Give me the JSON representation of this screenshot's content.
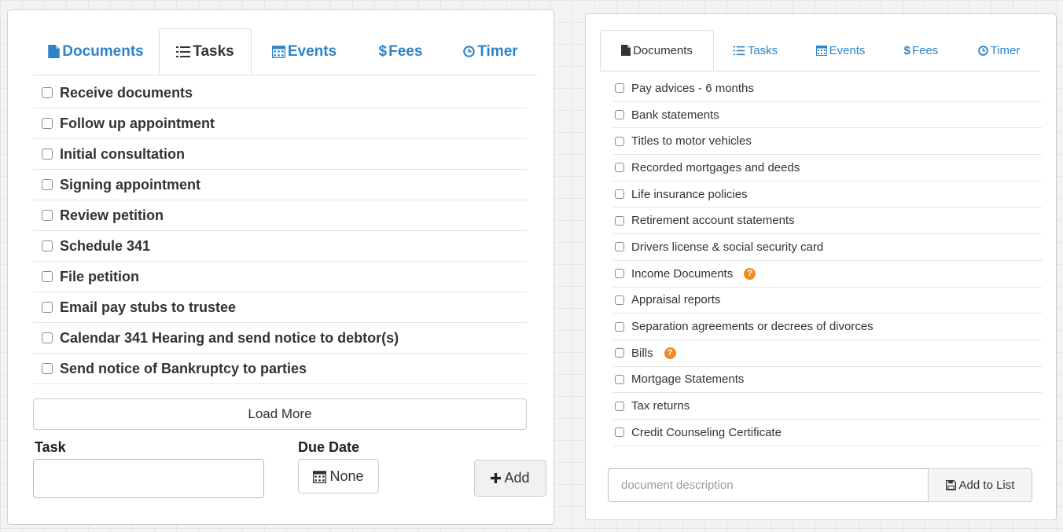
{
  "left_panel": {
    "tabs": [
      {
        "label": "Documents",
        "icon": "file-icon"
      },
      {
        "label": "Tasks",
        "icon": "list-icon"
      },
      {
        "label": "Events",
        "icon": "calendar-icon"
      },
      {
        "label": "Fees",
        "icon": "dollar-icon"
      },
      {
        "label": "Timer",
        "icon": "clock-icon"
      }
    ],
    "active_tab": "Tasks",
    "tasks": [
      "Receive documents",
      "Follow up appointment",
      "Initial consultation",
      "Signing appointment",
      "Review petition",
      "Schedule 341",
      "File petition",
      "Email pay stubs to trustee",
      "Calendar 341 Hearing and send notice to debtor(s)",
      "Send notice of Bankruptcy to parties"
    ],
    "load_more_label": "Load More",
    "task_label": "Task",
    "task_value": "",
    "due_date_label": "Due Date",
    "due_date_value": "None",
    "add_label": "Add"
  },
  "right_panel": {
    "tabs": [
      {
        "label": "Documents",
        "icon": "file-icon"
      },
      {
        "label": "Tasks",
        "icon": "list-icon"
      },
      {
        "label": "Events",
        "icon": "calendar-icon"
      },
      {
        "label": "Fees",
        "icon": "dollar-icon"
      },
      {
        "label": "Timer",
        "icon": "clock-icon"
      }
    ],
    "active_tab": "Documents",
    "documents": [
      {
        "label": "Pay advices - 6 months",
        "help": false
      },
      {
        "label": "Bank statements",
        "help": false
      },
      {
        "label": "Titles to motor vehicles",
        "help": false
      },
      {
        "label": "Recorded mortgages and deeds",
        "help": false
      },
      {
        "label": "Life insurance policies",
        "help": false
      },
      {
        "label": "Retirement account statements",
        "help": false
      },
      {
        "label": "Drivers license & social security card",
        "help": false
      },
      {
        "label": "Income Documents",
        "help": true
      },
      {
        "label": "Appraisal reports",
        "help": false
      },
      {
        "label": "Separation agreements or decrees of divorces",
        "help": false
      },
      {
        "label": "Bills",
        "help": true
      },
      {
        "label": "Mortgage Statements",
        "help": false
      },
      {
        "label": "Tax returns",
        "help": false
      },
      {
        "label": "Credit Counseling Certificate",
        "help": false
      }
    ],
    "description_placeholder": "document description",
    "add_to_list_label": "Add to List"
  },
  "colors": {
    "link_blue": "#2f83c8",
    "help_orange": "#ef8c26"
  }
}
